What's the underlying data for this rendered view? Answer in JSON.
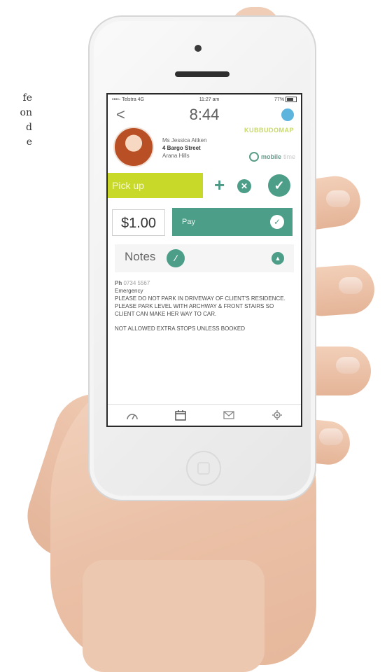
{
  "side_text": [
    "fe",
    "on",
    "d",
    "e"
  ],
  "status_bar": {
    "carrier": "••••◦ Telstra  4G",
    "time": "11:27 am",
    "battery": "77%"
  },
  "header": {
    "back_glyph": "<",
    "time": "8:44"
  },
  "client": {
    "name": "Ms Jessica Aitken",
    "street": "4 Bargo Street",
    "suburb": "Arana Hills",
    "brand_tag": "KUBBUDOMAP",
    "logo_text": "mobile",
    "logo_suffix": "time"
  },
  "actions": {
    "pickup_label": "Pick up",
    "plus_glyph": "+",
    "cancel_glyph": "✕",
    "confirm_glyph": "✓"
  },
  "payment": {
    "amount": "$1.00",
    "pay_label": "Pay",
    "check_glyph": "✓"
  },
  "notes": {
    "label": "Notes",
    "edit_glyph": "⁄",
    "collapse_glyph": "▲",
    "phone_prefix": "Ph",
    "phone": "0734 5567",
    "emergency": "Emergency",
    "instruction_1": "PLEASE DO NOT PARK IN DRIVEWAY OF CLIENT'S RESIDENCE. PLEASE PARK LEVEL WITH ARCHWAY & FRONT STAIRS SO CLIENT CAN MAKE HER WAY TO CAR.",
    "instruction_2": "NOT ALLOWED EXTRA STOPS UNLESS BOOKED"
  },
  "tabbar": {
    "icons": [
      "dashboard-icon",
      "calendar-icon",
      "mail-icon",
      "settings-icon"
    ]
  },
  "colors": {
    "accent_green": "#4d9e88",
    "lime": "#c8d92a",
    "blue": "#5db5dd"
  }
}
